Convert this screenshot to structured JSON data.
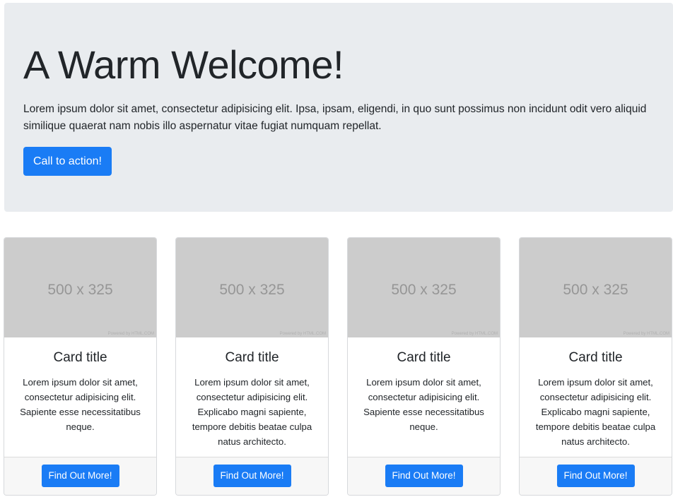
{
  "jumbotron": {
    "title": "A Warm Welcome!",
    "lead": "Lorem ipsum dolor sit amet, consectetur adipisicing elit. Ipsa, ipsam, eligendi, in quo sunt possimus non incidunt odit vero aliquid similique quaerat nam nobis illo aspernatur vitae fugiat numquam repellat.",
    "cta_label": "Call to action!"
  },
  "cards": [
    {
      "image_label": "500 x 325",
      "image_credit": "Powered by HTML.COM",
      "title": "Card title",
      "text": "Lorem ipsum dolor sit amet, consectetur adipisicing elit. Sapiente esse necessitatibus neque.",
      "button_label": "Find Out More!"
    },
    {
      "image_label": "500 x 325",
      "image_credit": "Powered by HTML.COM",
      "title": "Card title",
      "text": "Lorem ipsum dolor sit amet, consectetur adipisicing elit. Explicabo magni sapiente, tempore debitis beatae culpa natus architecto.",
      "button_label": "Find Out More!"
    },
    {
      "image_label": "500 x 325",
      "image_credit": "Powered by HTML.COM",
      "title": "Card title",
      "text": "Lorem ipsum dolor sit amet, consectetur adipisicing elit. Sapiente esse necessitatibus neque.",
      "button_label": "Find Out More!"
    },
    {
      "image_label": "500 x 325",
      "image_credit": "Powered by HTML.COM",
      "title": "Card title",
      "text": "Lorem ipsum dolor sit amet, consectetur adipisicing elit. Explicabo magni sapiente, tempore debitis beatae culpa natus architecto.",
      "button_label": "Find Out More!"
    }
  ],
  "colors": {
    "primary": "#1a7cf5",
    "jumbotron_bg": "#e9ecef",
    "placeholder_bg": "#cccccc",
    "footer_bg": "#f7f7f7"
  }
}
